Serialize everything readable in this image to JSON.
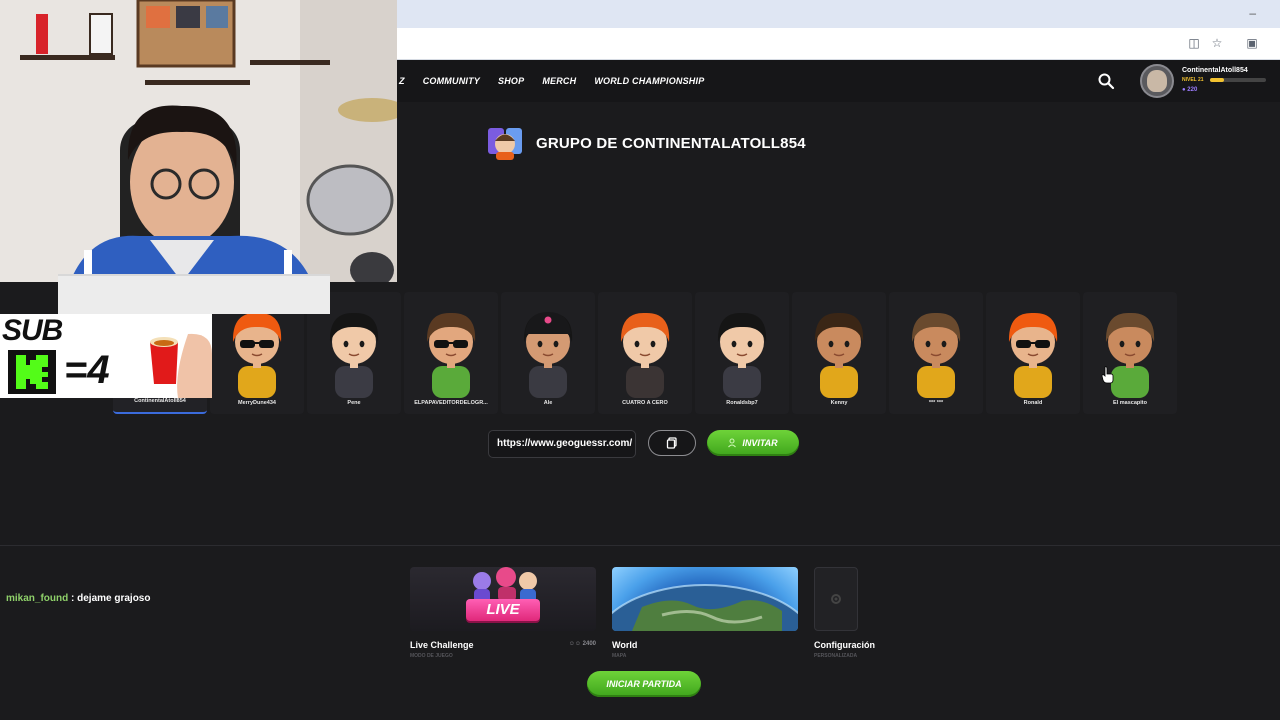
{
  "nav": {
    "partial": "Z",
    "items": [
      "COMMUNITY",
      "SHOP",
      "MERCH",
      "WORLD CHAMPIONSHIP"
    ]
  },
  "user": {
    "name": "ContinentalAtoll854",
    "level": "NIVEL 21",
    "coins": "220",
    "level_progress": 0.25
  },
  "group": {
    "title": "GRUPO DE CONTINENTALATOLL854"
  },
  "members": [
    {
      "name": "ContinentalAtoll854",
      "hair": "#2a1a12",
      "shirt": "#4a4a50",
      "skin": "#e8b48c",
      "glasses": false,
      "cap": false
    },
    {
      "name": "MerryDune434",
      "hair": "#ef5a10",
      "shirt": "#e1a71b",
      "skin": "#e8b48c",
      "glasses": true,
      "cap": false
    },
    {
      "name": "Pene",
      "hair": "#151515",
      "shirt": "#3b3b44",
      "skin": "#f0c9a8",
      "glasses": false,
      "cap": false
    },
    {
      "name": "ELPAPAVEDITORDELOGR...",
      "hair": "#5a3a22",
      "shirt": "#5aaa3a",
      "skin": "#e2a77e",
      "glasses": true,
      "cap": false
    },
    {
      "name": "Ale",
      "hair": "#151515",
      "shirt": "#3a3a42",
      "skin": "#d49a73",
      "glasses": false,
      "cap": true
    },
    {
      "name": "CUATRO A CERO",
      "hair": "#e8601a",
      "shirt": "#3b3434",
      "skin": "#f0c9a8",
      "glasses": false,
      "cap": false
    },
    {
      "name": "Ronaldsbp7",
      "hair": "#151515",
      "shirt": "#3b3b44",
      "skin": "#f0c9a8",
      "glasses": false,
      "cap": false
    },
    {
      "name": "Kenny",
      "hair": "#3a2616",
      "shirt": "#e1a71b",
      "skin": "#c98a5e",
      "glasses": false,
      "cap": false
    },
    {
      "name": "*** ***",
      "hair": "#6a4a2e",
      "shirt": "#e1a71b",
      "skin": "#c98a5e",
      "glasses": false,
      "cap": false
    },
    {
      "name": "Ronald",
      "hair": "#ef5a10",
      "shirt": "#e1a71b",
      "skin": "#e8b48c",
      "glasses": true,
      "cap": false
    },
    {
      "name": "El mascapito",
      "hair": "#6a4a2e",
      "shirt": "#5aaa3a",
      "skin": "#c98a5e",
      "glasses": false,
      "cap": false
    }
  ],
  "invite": {
    "link": "https://www.geoguessr.com/",
    "button": "INVITAR"
  },
  "modes": [
    {
      "label": "Live Challenge",
      "sub": "MODO DE JUEGO",
      "count": "2400",
      "badge": "LIVE"
    },
    {
      "label": "World",
      "sub": "MAPA"
    },
    {
      "label": "Configuración",
      "sub": "PERSONALIZADA"
    }
  ],
  "start": {
    "label": "INICIAR PARTIDA"
  },
  "overlay": {
    "sub": "SUB",
    "equation": "=4"
  },
  "chat": {
    "user": "mikan_found",
    "message": " : dejame grajoso"
  },
  "colors": {
    "accent_green": "#4fbd28",
    "bg": "#1b1b1d",
    "live_pink": "#f0429a"
  }
}
